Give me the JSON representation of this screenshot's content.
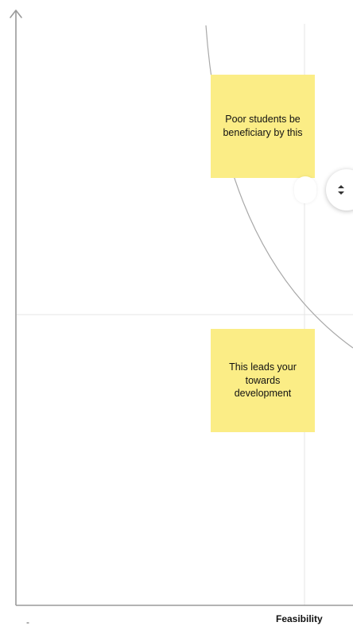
{
  "board": {
    "notes": [
      {
        "text": "Poor students be\nbeneficiary by this"
      },
      {
        "text": "This leads your\ntowards\ndevelopment"
      }
    ],
    "x_axis": {
      "min_label": "-",
      "label": "Feasibility"
    }
  },
  "icons": {
    "y_axis_arrow": "arrow-up-icon",
    "reorder": "chevron-up-down-icon"
  },
  "colors": {
    "sticky": "#fbed86",
    "axis": "#9a9a9a",
    "grid": "#e6e6e6"
  }
}
